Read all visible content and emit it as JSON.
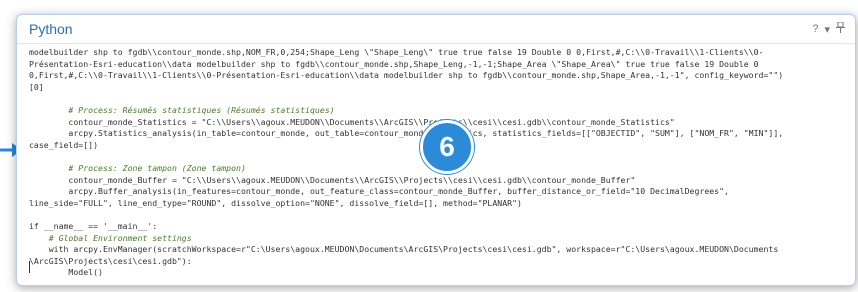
{
  "window": {
    "title": "Python",
    "help_label": "?",
    "menu_label": "▾",
    "pin_label": "⌄"
  },
  "annotation": {
    "badge_number": "6",
    "colors": {
      "badge": "#2b8bd9",
      "arrow": "#2b8bd9",
      "title": "#2a6ebb"
    }
  },
  "code_lines": [
    "modelbuilder shp to fgdb\\\\contour_monde.shp,NOM_FR,0,254;Shape_Leng \\\"Shape_Leng\\\" true true false 19 Double 0 0,First,#,C:\\\\0-Travail\\\\1-Clients\\\\0-",
    "Présentation-Esri-education\\\\data modelbuilder shp to fgdb\\\\contour_monde.shp,Shape_Leng,-1,-1;Shape_Area \\\"Shape_Area\\\" true true false 19 Double 0",
    "0,First,#,C:\\\\0-Travail\\\\1-Clients\\\\0-Présentation-Esri-education\\\\data modelbuilder shp to fgdb\\\\contour_monde.shp,Shape_Area,-1,-1\", config_keyword=\"\")",
    "[0]",
    "",
    "        # Process: Résumés statistiques (Résumés statistiques)",
    "        contour_monde_Statistics = \"C:\\\\Users\\\\agoux.MEUDON\\\\Documents\\\\ArcGIS\\\\Projects\\\\cesi\\\\cesi.gdb\\\\contour_monde_Statistics\"",
    "        arcpy.Statistics_analysis(in_table=contour_monde, out_table=contour_monde_Statistics, statistics_fields=[[\"OBJECTID\", \"SUM\"], [\"NOM_FR\", \"MIN\"]],",
    "case_field=[])",
    "",
    "        # Process: Zone tampon (Zone tampon)",
    "        contour_monde_Buffer = \"C:\\\\Users\\\\agoux.MEUDON\\\\Documents\\\\ArcGIS\\\\Projects\\\\cesi\\\\cesi.gdb\\\\contour_monde_Buffer\"",
    "        arcpy.Buffer_analysis(in_features=contour_monde, out_feature_class=contour_monde_Buffer, buffer_distance_or_field=\"10 DecimalDegrees\",",
    "line_side=\"FULL\", line_end_type=\"ROUND\", dissolve_option=\"NONE\", dissolve_field=[], method=\"PLANAR\")",
    "",
    "if __name__ == '__main__':",
    "    # Global Environment settings",
    "    with arcpy.EnvManager(scratchWorkspace=r\"C:\\Users\\agoux.MEUDON\\Documents\\ArcGIS\\Projects\\cesi\\cesi.gdb\", workspace=r\"C:\\Users\\agoux.MEUDON\\Documents",
    "\\ArcGIS\\Projects\\cesi\\cesi.gdb\"):",
    "        Model()"
  ]
}
